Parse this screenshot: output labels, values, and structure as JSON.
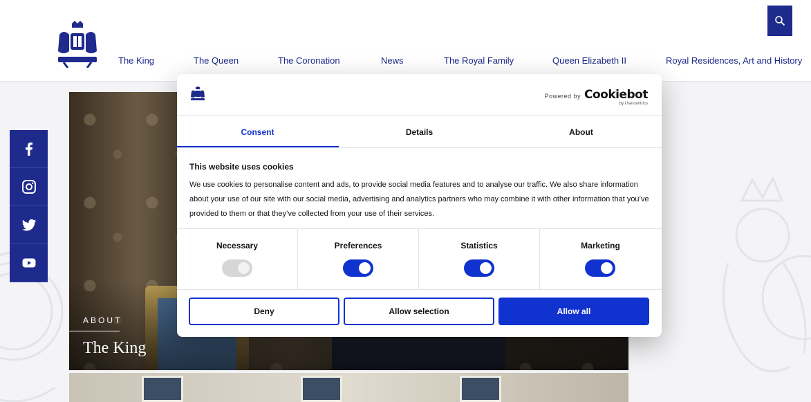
{
  "nav": {
    "items": [
      {
        "label": "The King"
      },
      {
        "label": "The Queen"
      },
      {
        "label": "The Coronation"
      },
      {
        "label": "News"
      },
      {
        "label": "The Royal Family"
      },
      {
        "label": "Queen Elizabeth II"
      },
      {
        "label": "Royal Residences, Art and History"
      }
    ],
    "search_icon": "search-icon",
    "logo_icon": "royal-coat-of-arms"
  },
  "social": {
    "items": [
      {
        "icon": "facebook-icon"
      },
      {
        "icon": "instagram-icon"
      },
      {
        "icon": "twitter-icon"
      },
      {
        "icon": "youtube-icon"
      }
    ]
  },
  "hero": {
    "label": "ABOUT",
    "title": "The King"
  },
  "cookie_dialog": {
    "powered_by": "Powered by",
    "brand": "Cookiebot",
    "brand_sub": "by Usercentrics",
    "tabs": [
      {
        "label": "Consent",
        "active": true
      },
      {
        "label": "Details",
        "active": false
      },
      {
        "label": "About",
        "active": false
      }
    ],
    "heading": "This website uses cookies",
    "body": "We use cookies to personalise content and ads, to provide social media features and to analyse our traffic. We also share information about your use of our site with our social media, advertising and analytics partners who may combine it with other information that you’ve provided to them or that they’ve collected from your use of their services.",
    "categories": [
      {
        "label": "Necessary",
        "enabled": true,
        "locked": true
      },
      {
        "label": "Preferences",
        "enabled": true,
        "locked": false
      },
      {
        "label": "Statistics",
        "enabled": true,
        "locked": false
      },
      {
        "label": "Marketing",
        "enabled": true,
        "locked": false
      }
    ],
    "buttons": {
      "deny": "Deny",
      "allow_selection": "Allow selection",
      "allow_all": "Allow all"
    }
  },
  "colors": {
    "brand_navy": "#1e2a8c",
    "cookiebot_blue": "#1032cf"
  }
}
